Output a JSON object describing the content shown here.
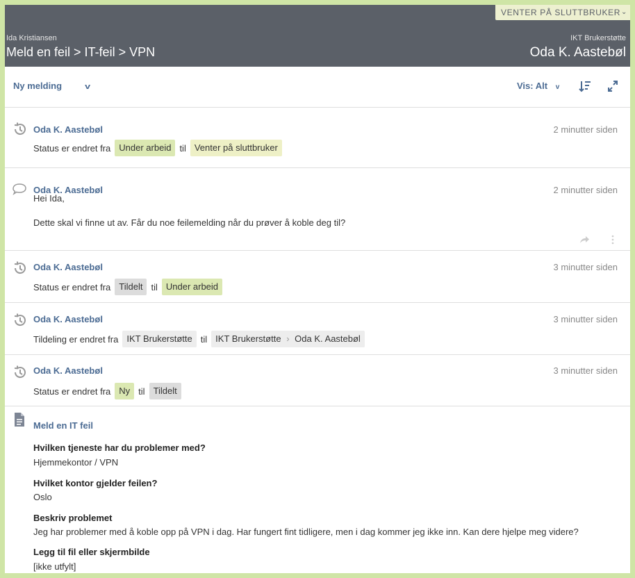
{
  "header": {
    "status_pill": "VENTER PÅ SLUTTBRUKER",
    "requester": "Ida Kristiansen",
    "breadcrumb": "Meld en feil > IT-feil > VPN",
    "team": "IKT Brukerstøtte",
    "assignee": "Oda K. Aastebøl"
  },
  "toolbar": {
    "new_message": "Ny melding",
    "view_filter": "Vis: Alt"
  },
  "entries": [
    {
      "author": "Oda K. Aastebøl",
      "time": "2 minutter siden",
      "text": "Status er endret fra",
      "from": "Under arbeid",
      "to_word": "til",
      "to": "Venter på sluttbruker"
    },
    {
      "author": "Oda K. Aastebøl",
      "time": "2 minutter siden",
      "greeting": "Hei Ida,",
      "body": "Dette skal vi finne ut av. Får du noe feilemelding når du prøver å koble deg til?"
    },
    {
      "author": "Oda K. Aastebøl",
      "time": "3 minutter siden",
      "text": "Status er endret fra",
      "from": "Tildelt",
      "to_word": "til",
      "to": "Under arbeid"
    },
    {
      "author": "Oda K. Aastebøl",
      "time": "3 minutter siden",
      "text": "Tildeling er endret fra",
      "from": "IKT Brukerstøtte",
      "to_word": "til",
      "to_group": "IKT Brukerstøtte",
      "to_person": "Oda K. Aastebøl"
    },
    {
      "author": "Oda K. Aastebøl",
      "time": "3 minutter siden",
      "text": "Status er endret fra",
      "from": "Ny",
      "to_word": "til",
      "to": "Tildelt"
    }
  ],
  "form": {
    "title": "Meld en IT feil",
    "fields": [
      {
        "q": "Hvilken tjeneste har du problemer med?",
        "a": "Hjemmekontor / VPN"
      },
      {
        "q": "Hvilket kontor gjelder feilen?",
        "a": "Oslo"
      },
      {
        "q": "Beskriv problemet",
        "a": "Jeg har problemer med å koble opp på VPN i dag. Har fungert fint tidligere, men i dag kommer jeg ikke inn. Kan dere hjelpe meg videre?"
      },
      {
        "q": "Legg til fil eller skjermbilde",
        "a": "[ikke utfylt]"
      }
    ]
  },
  "colors": {
    "frame_border": "#cfe5a6",
    "header_bg": "#5b6068",
    "link_blue": "#4b6b93",
    "tag_green": "#dbe8b2",
    "tag_yellow": "#eef0c6",
    "tag_grey": "#dcdcdc"
  },
  "icons": [
    "history-icon",
    "comment-icon",
    "share-icon",
    "more-icon",
    "sort-icon",
    "expand-icon",
    "document-icon",
    "chevron-down-icon"
  ]
}
